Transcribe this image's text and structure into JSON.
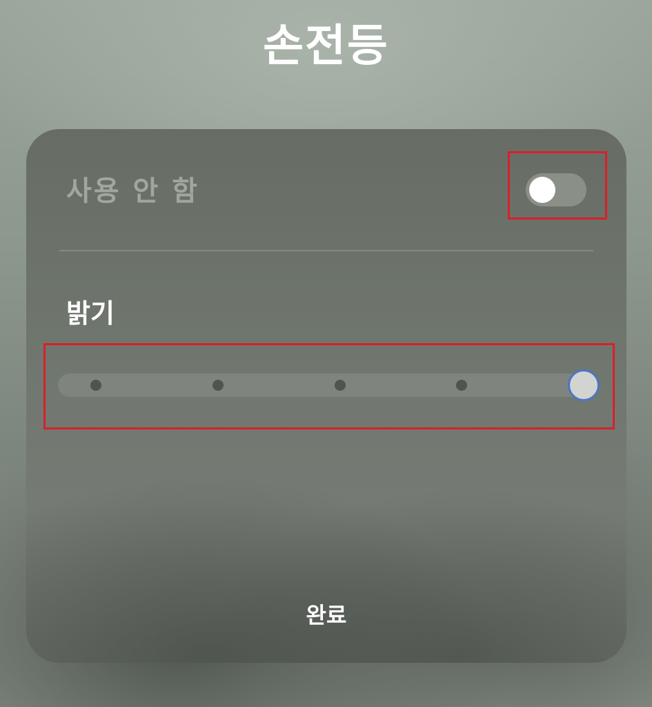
{
  "page": {
    "title": "손전등"
  },
  "flashlight_toggle": {
    "label": "사용 안 함",
    "on": false
  },
  "brightness": {
    "label": "밝기",
    "levels": 5,
    "current_level": 5
  },
  "actions": {
    "done_label": "완료"
  },
  "colors": {
    "highlight_outline": "#d8202a",
    "slider_thumb_ring": "#4f74c4",
    "toggle_knob": "#ffffff"
  }
}
